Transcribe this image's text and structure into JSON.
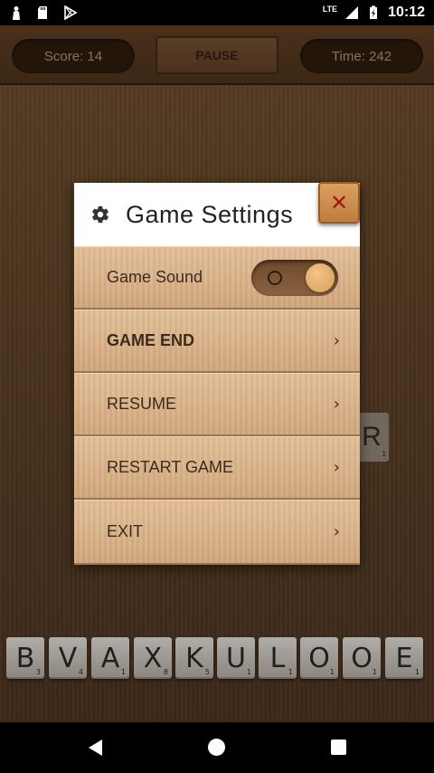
{
  "status_bar": {
    "time": "10:12",
    "network": "LTE",
    "icons": [
      "person-icon",
      "sd-card-icon",
      "play-store-icon",
      "signal-icon",
      "battery-icon"
    ]
  },
  "top_bar": {
    "score": "Score: 14",
    "pause": "PAUSE",
    "time": "Time: 242"
  },
  "dialog": {
    "title": "Game Settings",
    "close_icon": "close-icon",
    "gear_icon": "gear-icon",
    "sound": {
      "label": "Game Sound",
      "enabled": true
    },
    "items": [
      {
        "label": "GAME END"
      },
      {
        "label": "RESUME"
      },
      {
        "label": "RESTART GAME"
      },
      {
        "label": "EXIT"
      }
    ],
    "chevron": "›"
  },
  "background_tile": {
    "letter": "R",
    "points": "1"
  },
  "rack": [
    {
      "letter": "B",
      "points": "3"
    },
    {
      "letter": "V",
      "points": "4"
    },
    {
      "letter": "A",
      "points": "1"
    },
    {
      "letter": "X",
      "points": "8"
    },
    {
      "letter": "K",
      "points": "5"
    },
    {
      "letter": "U",
      "points": "1"
    },
    {
      "letter": "L",
      "points": "1"
    },
    {
      "letter": "O",
      "points": "1"
    },
    {
      "letter": "O",
      "points": "1"
    },
    {
      "letter": "E",
      "points": "1"
    }
  ],
  "colors": {
    "accent": "#d99c58",
    "close_x": "#9b1a14",
    "menu_row": "#dcb48b"
  }
}
